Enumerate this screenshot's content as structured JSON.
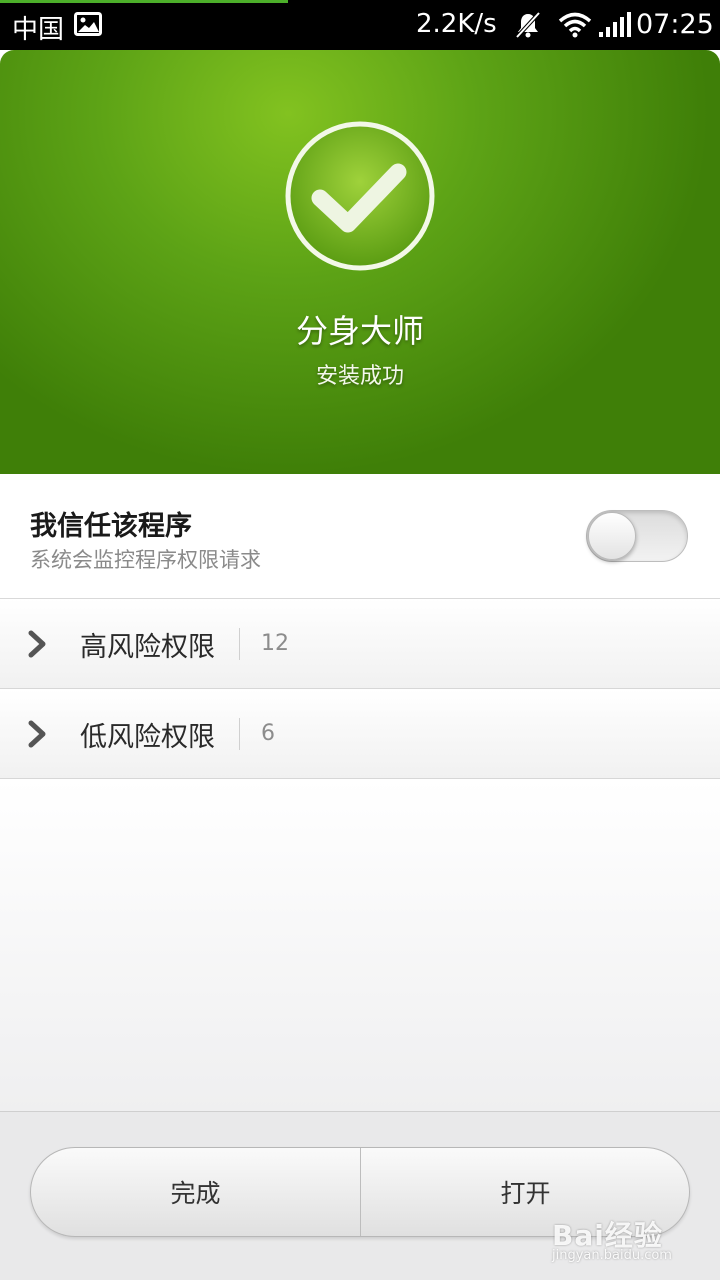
{
  "status_bar": {
    "carrier": "中国",
    "net_speed": "2.2K/s",
    "time": "07:25",
    "icons": [
      "gallery-icon",
      "bell-muted-icon",
      "wifi-icon",
      "signal-icon"
    ]
  },
  "header": {
    "app_name": "分身大师",
    "install_status": "安装成功",
    "icon": "check-icon",
    "colors": {
      "gradient_light": "#82c220",
      "gradient_dark": "#3f7f08"
    }
  },
  "trust": {
    "title": "我信任该程序",
    "subtitle": "系统会监控程序权限请求",
    "toggle_on": false
  },
  "permissions": [
    {
      "label": "高风险权限",
      "count": "12"
    },
    {
      "label": "低风险权限",
      "count": "6"
    }
  ],
  "buttons": {
    "done": "完成",
    "open": "打开"
  },
  "watermark": {
    "logo": "Bai经验",
    "url": "jingyan.baidu.com"
  }
}
